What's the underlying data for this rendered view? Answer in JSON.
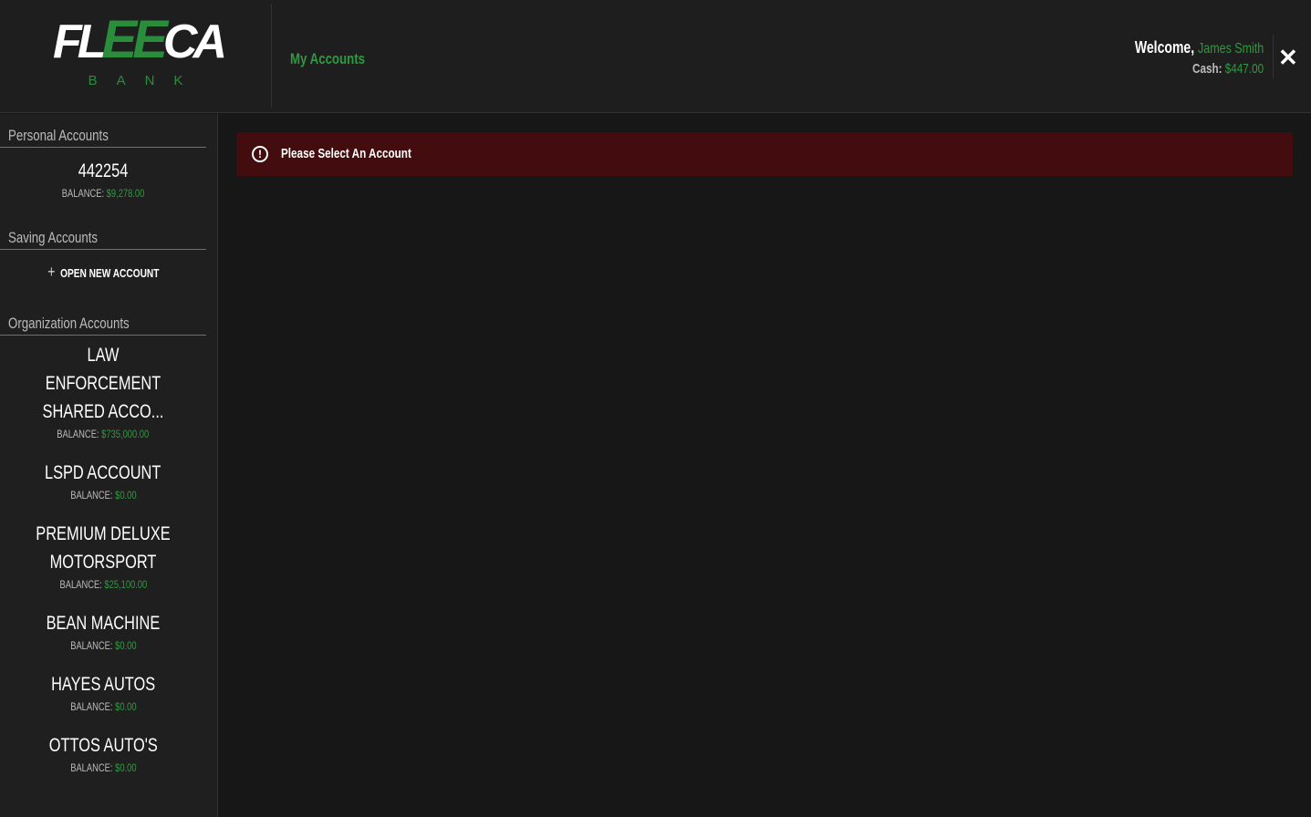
{
  "logo": {
    "part1": "FL",
    "part2": "EE",
    "part3": "CA",
    "sub": "BANK"
  },
  "nav": {
    "my_accounts": "My Accounts"
  },
  "user": {
    "welcome": "Welcome,",
    "name": "James Smith",
    "cash_label": "Cash:",
    "cash": "$447.00"
  },
  "sidebar": {
    "personal_title": "Personal Accounts",
    "personal": [
      {
        "name": "442254",
        "balance_label": "BALANCE:",
        "balance": "$9,278.00"
      }
    ],
    "saving_title": "Saving Accounts",
    "open_new": "OPEN NEW ACCOUNT",
    "org_title": "Organization Accounts",
    "org": [
      {
        "name": "LAW ENFORCEMENT SHARED ACCO...",
        "balance_label": "BALANCE:",
        "balance": "$735,000.00"
      },
      {
        "name": "LSPD ACCOUNT",
        "balance_label": "BALANCE:",
        "balance": "$0.00"
      },
      {
        "name": "PREMIUM DELUXE MOTORSPORT",
        "balance_label": "BALANCE:",
        "balance": "$25,100.00"
      },
      {
        "name": "BEAN MACHINE",
        "balance_label": "BALANCE:",
        "balance": "$0.00"
      },
      {
        "name": "HAYES AUTOS",
        "balance_label": "BALANCE:",
        "balance": "$0.00"
      },
      {
        "name": "OTTOS AUTO'S",
        "balance_label": "BALANCE:",
        "balance": "$0.00"
      }
    ]
  },
  "alert": {
    "text": "Please Select An Account",
    "icon": "alert-circle-icon"
  }
}
